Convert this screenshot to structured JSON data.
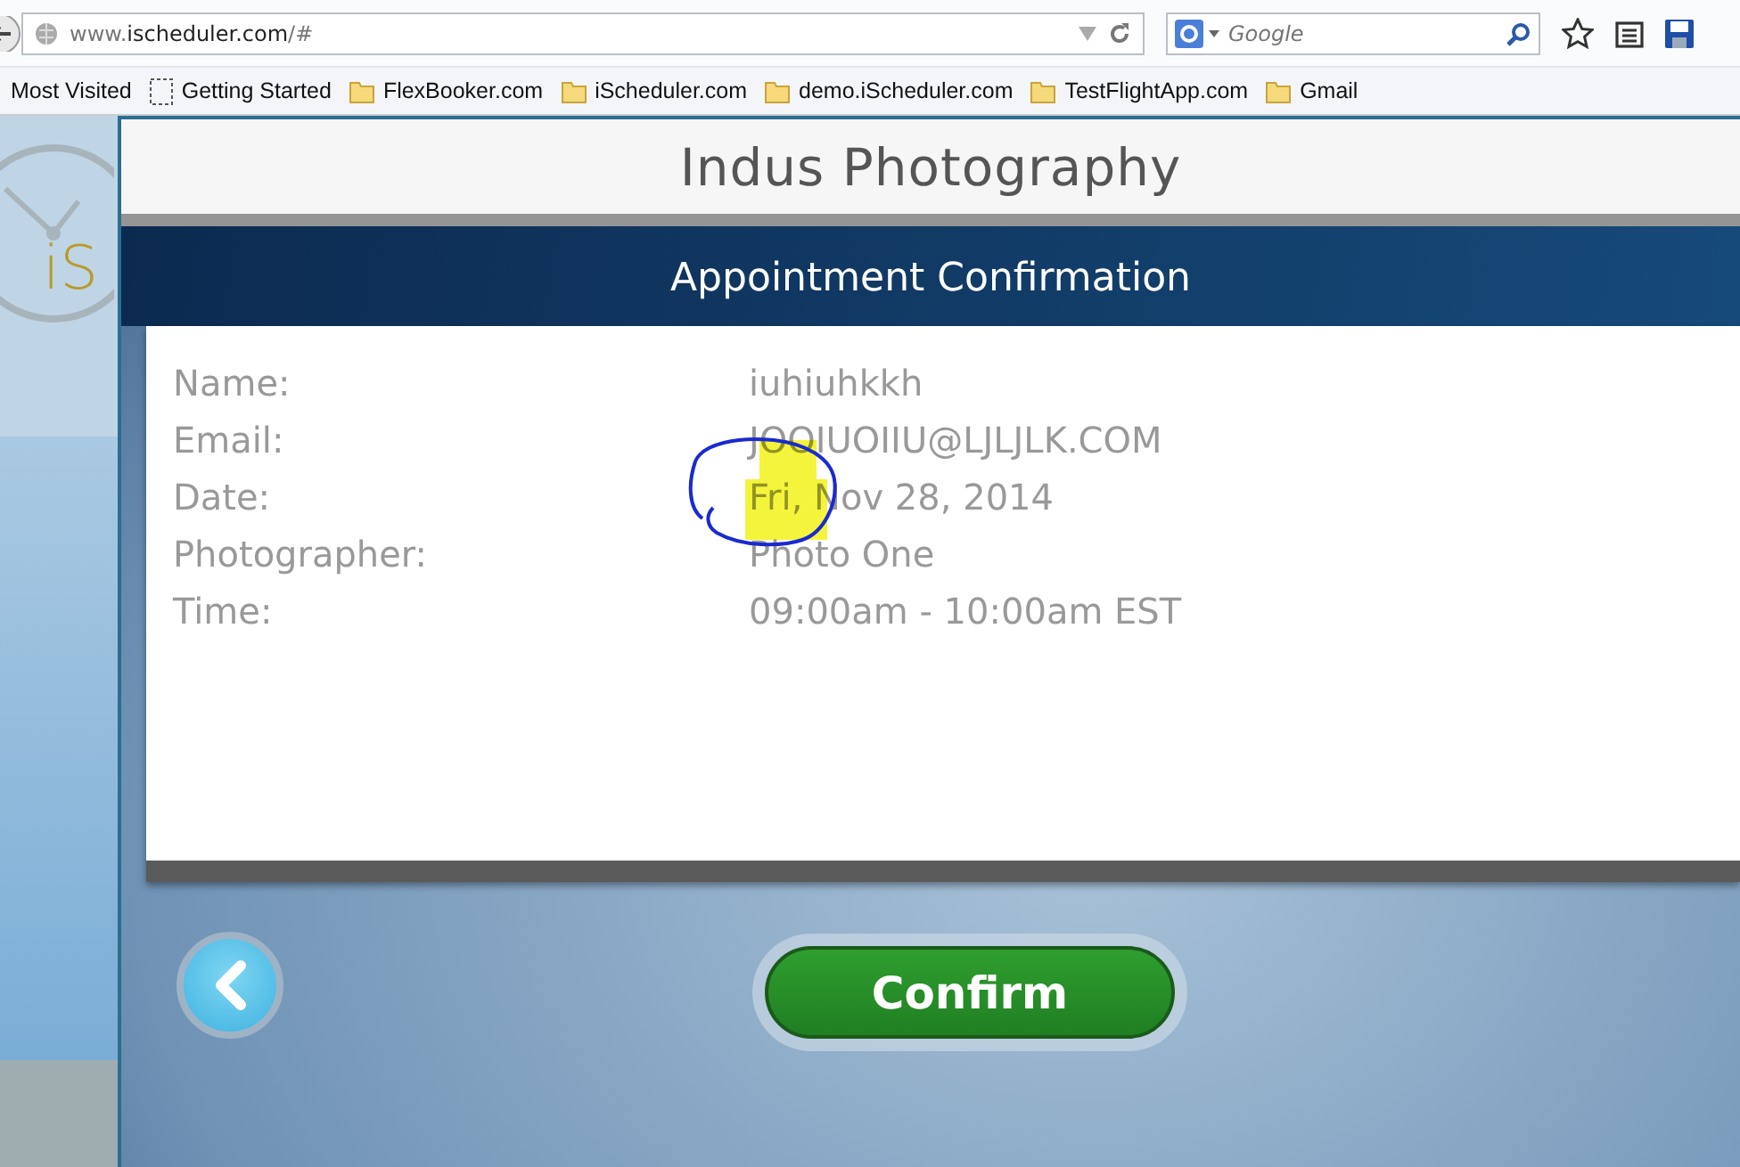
{
  "browser": {
    "url_host": "www.",
    "url_domain": "ischeduler.com",
    "url_path": "/#",
    "search_placeholder": "Google"
  },
  "bookmarks": [
    {
      "label": "Most Visited",
      "kind": "plain"
    },
    {
      "label": "Getting Started",
      "kind": "page"
    },
    {
      "label": "FlexBooker.com",
      "kind": "folder"
    },
    {
      "label": "iScheduler.com",
      "kind": "folder"
    },
    {
      "label": "demo.iScheduler.com",
      "kind": "folder"
    },
    {
      "label": "TestFlightApp.com",
      "kind": "folder"
    },
    {
      "label": "Gmail",
      "kind": "folder"
    }
  ],
  "logo_text": "iS",
  "header": {
    "title": "Indus Photography",
    "subtitle": "Appointment Confirmation"
  },
  "details": [
    {
      "label": "Name:",
      "value": "iuhiuhkkh"
    },
    {
      "label": "Email:",
      "value": "JOOIUOIIU@LJLJLK.COM"
    },
    {
      "label": "Date:",
      "value": "Fri, Nov 28, 2014"
    },
    {
      "label": "Photographer:",
      "value": "Photo One"
    },
    {
      "label": "Time:",
      "value": "09:00am - 10:00am EST"
    }
  ],
  "confirm_label": "Confirm"
}
